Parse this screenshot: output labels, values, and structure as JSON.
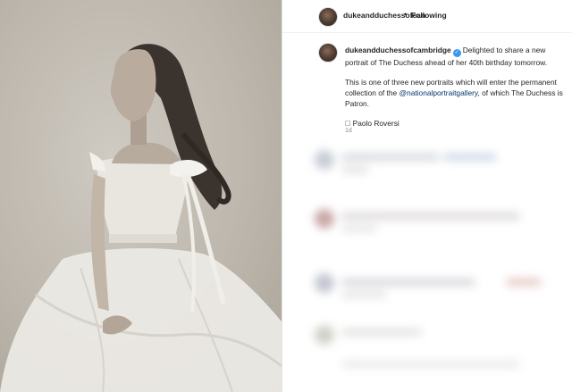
{
  "header": {
    "username": "dukeandduchessofcan",
    "separator": "•",
    "follow_status": "Following"
  },
  "caption": {
    "username": "dukeandduchessofcambridge",
    "verified_mark": "✓",
    "line1": "Delighted to share a new portrait of The Duchess ahead of her 40th birthday tomorrow.",
    "line2_start": "This is one of three new portraits which will enter the permanent collection of the ",
    "line2_mention": "@nationalportraitgallery",
    "line2_end": ", of which The Duchess is Patron.",
    "credit": "\u0000 Paolo Roversi",
    "time": "1d"
  },
  "photo": {
    "subject": "black-and-white portrait of a woman in a white tulle gown"
  },
  "colors": {
    "link": "#00376b",
    "verified": "#3897f0",
    "meta": "#8e8e8e"
  }
}
